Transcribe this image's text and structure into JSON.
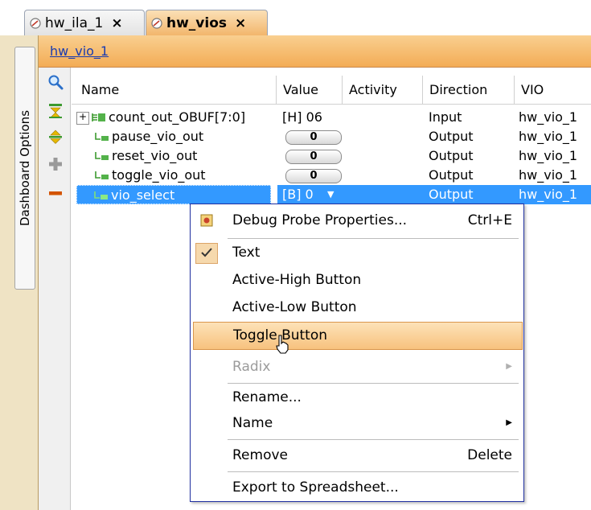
{
  "tabs": [
    {
      "label": "hw_ila_1",
      "close": "×"
    },
    {
      "label": "hw_vios",
      "close": "×"
    }
  ],
  "sidebar": {
    "dashboard_options": "Dashboard Options"
  },
  "header": {
    "link": "hw_vio_1"
  },
  "table": {
    "columns": [
      "Name",
      "Value",
      "Activity",
      "Direction",
      "VIO"
    ],
    "rows": [
      {
        "name": "count_out_OBUF[7:0]",
        "value": "[H] 06",
        "activity": "",
        "direction": "Input",
        "vio": "hw_vio_1"
      },
      {
        "name": "pause_vio_out",
        "value": "0",
        "activity": "",
        "direction": "Output",
        "vio": "hw_vio_1"
      },
      {
        "name": "reset_vio_out",
        "value": "0",
        "activity": "",
        "direction": "Output",
        "vio": "hw_vio_1"
      },
      {
        "name": "toggle_vio_out",
        "value": "0",
        "activity": "",
        "direction": "Output",
        "vio": "hw_vio_1"
      },
      {
        "name": "vio_select",
        "value": "[B] 0",
        "activity": "",
        "direction": "Output",
        "vio": "hw_vio_1"
      }
    ]
  },
  "context_menu": {
    "items": [
      {
        "label": "Debug Probe Properties...",
        "shortcut": "Ctrl+E"
      },
      {
        "label": "Text"
      },
      {
        "label": "Active-High Button"
      },
      {
        "label": "Active-Low Button"
      },
      {
        "label": "Toggle Button"
      },
      {
        "label": "Radix"
      },
      {
        "label": "Rename..."
      },
      {
        "label": "Name"
      },
      {
        "label": "Remove",
        "shortcut": "Delete"
      },
      {
        "label": "Export to Spreadsheet..."
      }
    ]
  },
  "colors": {
    "accent": "#f3ac55",
    "selection": "#3399ff",
    "menu_border": "#1f2fa0"
  },
  "icons": [
    "probe-tab-icon",
    "search-icon",
    "collapse-all-icon",
    "expand-all-icon",
    "add-icon",
    "remove-icon",
    "bus-icon",
    "signal-icon",
    "checkmark-icon",
    "properties-icon",
    "mouse-cursor-icon"
  ]
}
